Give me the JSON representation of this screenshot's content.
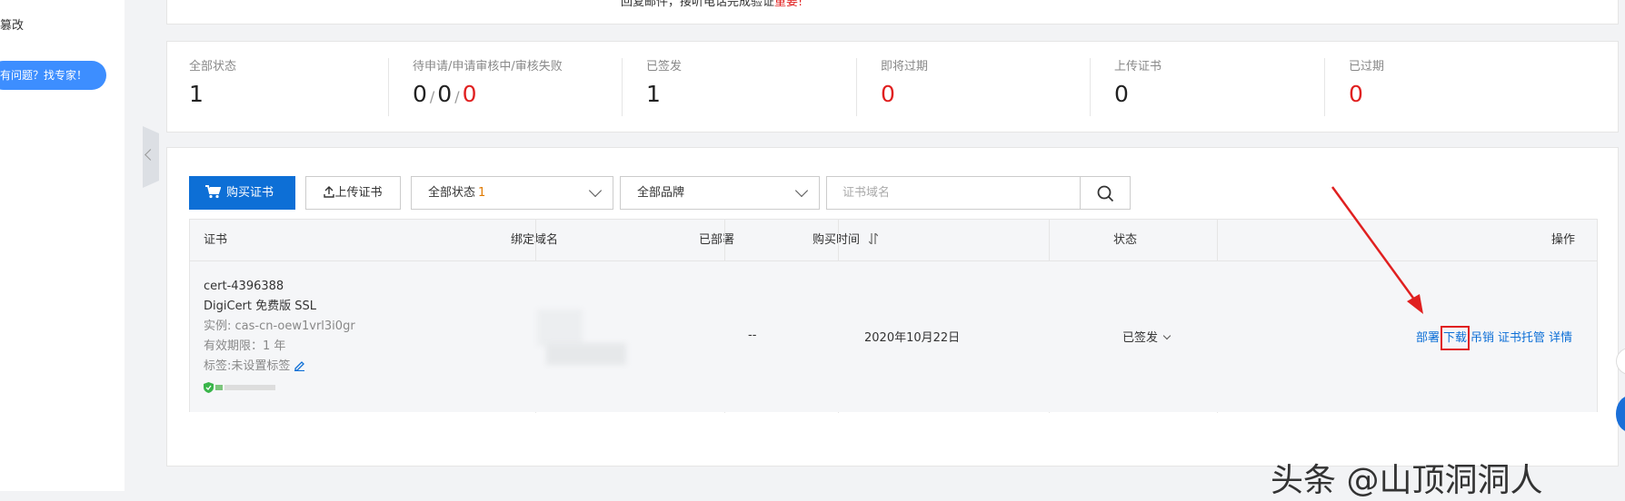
{
  "sidebar": {
    "modify_label": "篡改",
    "expert_button": "有问题？找专家！"
  },
  "top_notice": {
    "text": "回复邮件，接听电话完成验证",
    "red": "重要!"
  },
  "stats": [
    {
      "label": "全部状态",
      "value": "1",
      "red": false
    },
    {
      "label": "待申请/申请审核中/审核失败",
      "values": [
        "0",
        "0",
        "0"
      ]
    },
    {
      "label": "已签发",
      "value": "1",
      "red": false
    },
    {
      "label": "即将过期",
      "value": "0",
      "red": true
    },
    {
      "label": "上传证书",
      "value": "0",
      "red": false
    },
    {
      "label": "已过期",
      "value": "0",
      "red": true
    }
  ],
  "toolbar": {
    "buy_label": "购买证书",
    "upload_label": "上传证书",
    "status_select": "全部状态",
    "status_count": "1",
    "brand_select": "全部品牌",
    "search_placeholder": "证书域名"
  },
  "table": {
    "headers": {
      "cert": "证书",
      "domain": "绑定域名",
      "deployed": "已部署",
      "purchase_time": "购买时间",
      "status": "状态",
      "actions": "操作"
    },
    "row": {
      "cert_id": "cert-4396388",
      "cert_name": "DigiCert 免费版 SSL",
      "instance": "实例: cas-cn-oew1vrl3i0gr",
      "validity": "有效期限：1 年",
      "tag": "标签:未设置标签",
      "deployed": "--",
      "purchase_date": "2020年10月22日",
      "status": "已签发",
      "actions": [
        "部署",
        "下载",
        "吊销",
        "证书托管",
        "详情"
      ]
    }
  },
  "watermark": "头条 @山顶洞洞人",
  "colors": {
    "primary": "#0d6fd6",
    "danger": "#e02020",
    "expert_btn": "#3d8eff"
  }
}
